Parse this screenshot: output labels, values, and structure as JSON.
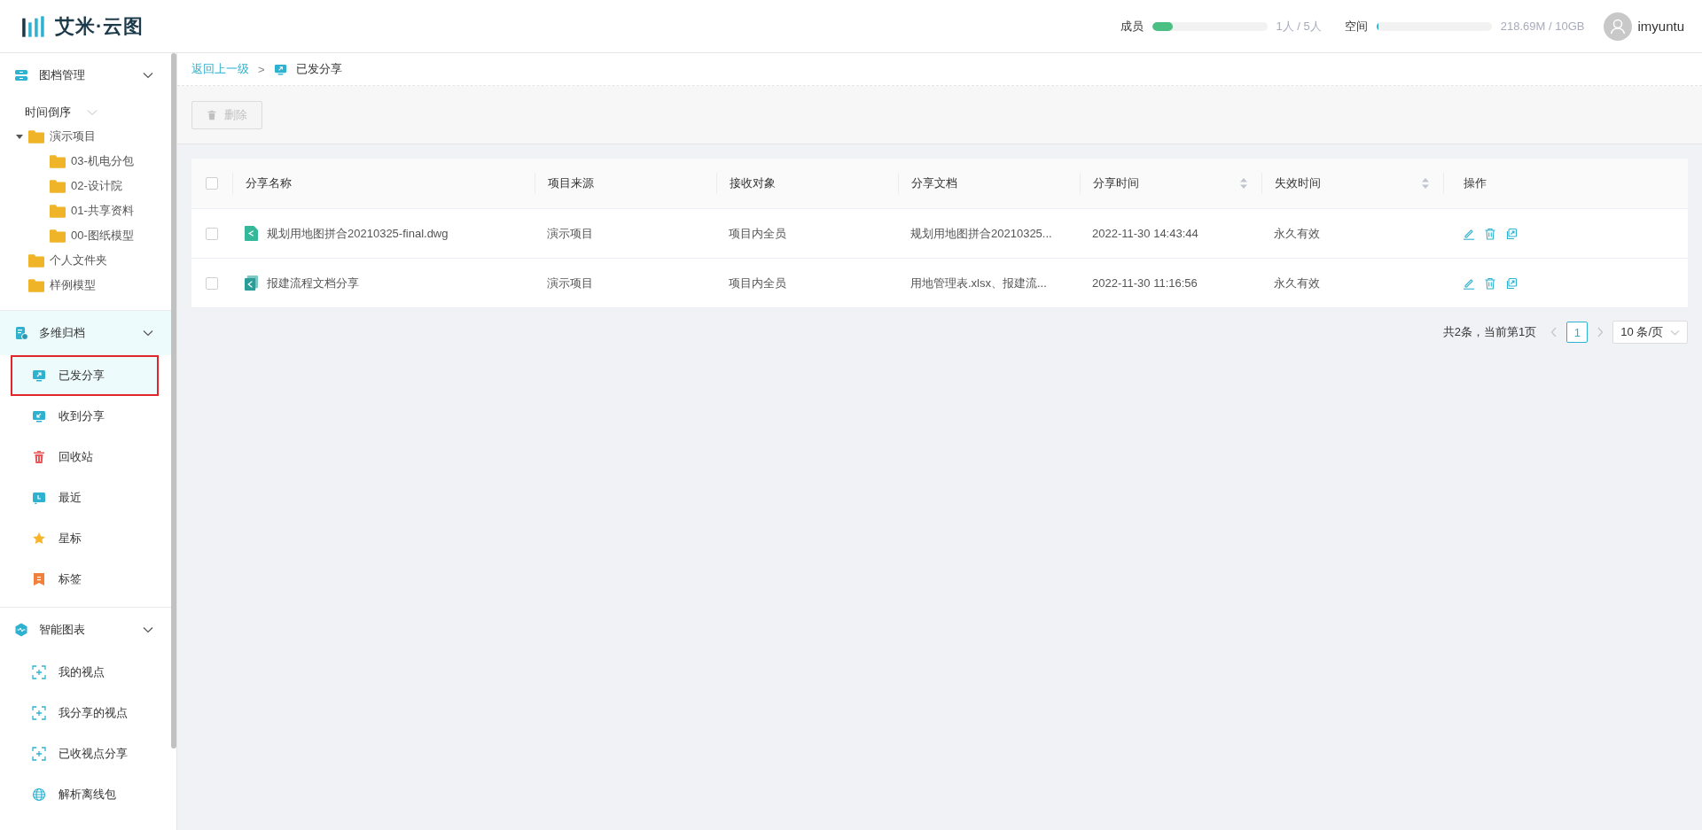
{
  "header": {
    "logo_text": "艾米·云图",
    "members": {
      "label": "成员",
      "level": 0.18,
      "reading": "1人 / 5人"
    },
    "space": {
      "label": "空间",
      "level": 0.02,
      "reading": "218.69M / 10GB"
    },
    "user": "imyuntu"
  },
  "sidebar": {
    "sections": [
      {
        "title": "图档管理",
        "kind": "archive",
        "active": false,
        "expanded": true,
        "sort_label": "时间倒序",
        "tree": [
          {
            "label": "演示项目",
            "expanded": true,
            "children": [
              {
                "label": "03-机电分包"
              },
              {
                "label": "02-设计院"
              },
              {
                "label": "01-共享资料"
              },
              {
                "label": "00-图纸模型"
              }
            ]
          },
          {
            "label": "个人文件夹"
          },
          {
            "label": "样例模型"
          }
        ]
      },
      {
        "title": "多维归档",
        "kind": "files",
        "active": true,
        "expanded": true,
        "items": [
          {
            "label": "已发分享",
            "kind": "sent",
            "selected": true
          },
          {
            "label": "收到分享",
            "kind": "received",
            "selected": false
          },
          {
            "label": "回收站",
            "kind": "trash",
            "selected": false
          },
          {
            "label": "最近",
            "kind": "recent",
            "selected": false
          },
          {
            "label": "星标",
            "kind": "star",
            "selected": false
          },
          {
            "label": "标签",
            "kind": "tag",
            "selected": false
          }
        ]
      },
      {
        "title": "智能图表",
        "kind": "chart",
        "active": false,
        "expanded": true,
        "items": [
          {
            "label": "我的视点",
            "kind": "viewpoint",
            "selected": false
          },
          {
            "label": "我分享的视点",
            "kind": "viewpoint",
            "selected": false
          },
          {
            "label": "已收视点分享",
            "kind": "viewpoint",
            "selected": false
          },
          {
            "label": "解析离线包",
            "kind": "globe",
            "selected": false
          }
        ]
      }
    ]
  },
  "breadcrumb": {
    "back": "返回上一级",
    "separator": ">",
    "current": "已发分享"
  },
  "toolbar": {
    "delete_button": {
      "label": "删除",
      "disabled": true
    }
  },
  "table": {
    "select_all_checked": false,
    "columns": [
      {
        "label": "分享名称",
        "sortable": false
      },
      {
        "label": "项目来源",
        "sortable": false
      },
      {
        "label": "接收对象",
        "sortable": false
      },
      {
        "label": "分享文档",
        "sortable": false
      },
      {
        "label": "分享时间",
        "sortable": true
      },
      {
        "label": "失效时间",
        "sortable": true
      },
      {
        "label": "操作",
        "sortable": false
      }
    ],
    "rows": [
      {
        "selected": false,
        "kind": "file",
        "name": "规划用地图拼合20210325-final.dwg",
        "source": "演示项目",
        "recipient": "项目内全员",
        "documents": "规划用地图拼合20210325...",
        "share_time": "2022-11-30 14:43:44",
        "expire": "永久有效"
      },
      {
        "selected": false,
        "kind": "folder",
        "name": "报建流程文档分享",
        "source": "演示项目",
        "recipient": "项目内全员",
        "documents": "用地管理表.xlsx、报建流...",
        "share_time": "2022-11-30 11:16:56",
        "expire": "永久有效"
      }
    ]
  },
  "pagination": {
    "summary": "共2条，当前第1页",
    "pages": [
      {
        "label": "1",
        "selected": true
      }
    ],
    "page_size": "10 条/页"
  }
}
